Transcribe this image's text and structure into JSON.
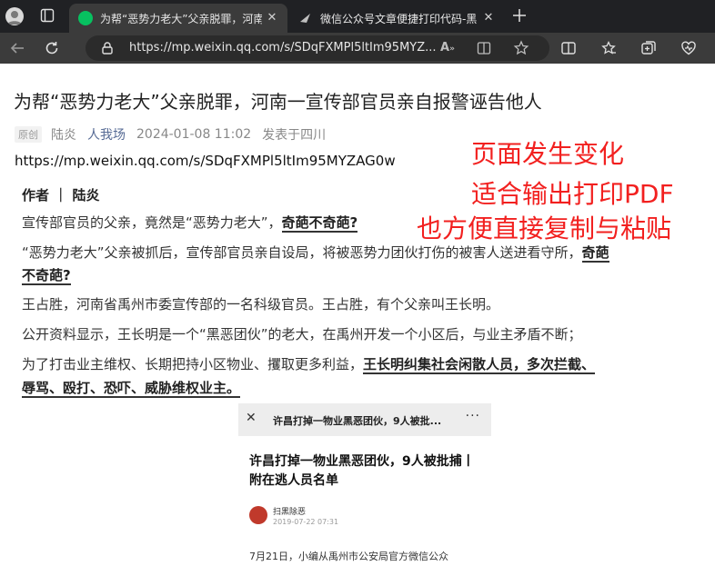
{
  "browser": {
    "tabs": [
      {
        "title": "为帮“恶势力老大”父亲脱罪，河南",
        "active": true
      },
      {
        "title": "微信公众号文章便捷打印代码-黑",
        "active": false
      }
    ],
    "url": "https://mp.weixin.qq.com/s/SDqFXMPl5ltIm95MYZ..."
  },
  "article": {
    "title": "为帮“恶势力老大”父亲脱罪，河南一宣传部官员亲自报警诬告他人",
    "original_badge": "原创",
    "author": "陆炎",
    "account": "人我场",
    "datetime": "2024-01-08 11:02",
    "location": "发表于四川",
    "source_url": "https://mp.weixin.qq.com/s/SDqFXMPl5ltIm95MYZAG0w",
    "byline": "作者 ｜ 陆炎",
    "p1_text": "宣传部官员的父亲，竟然是“恶势力老大”，",
    "p1_bold": "奇葩不奇葩?",
    "p2_text": "“恶势力老大”父亲被抓后，宣传部官员亲自设局，将被恶势力团伙打伤的被害人送进看守所，",
    "p2_bold_a": "奇葩",
    "p2_bold_b": "不奇葩?",
    "p3": "王占胜，河南省禹州市委宣传部的一名科级官员。王占胜，有个父亲叫王长明。",
    "p4": "公开资料显示，王长明是一个“黑恶团伙”的老大，在禹州开发一个小区后，与业主矛盾不断；",
    "p5_text": "为了打击业主维权、长期把持小区物业、攫取更多利益，",
    "p5_bold_a": "王长明纠集社会闲散人员，多次拦截、",
    "p5_bold_b": "辱骂、殴打、恐吓、威胁维权业主。"
  },
  "overlay": {
    "line1": "页面发生变化",
    "line2": "适合输出打印PDF",
    "line3": "也方便直接复制与粘贴",
    "color": "#f2201f"
  },
  "card": {
    "top_title": "许昌打掉一物业黑恶团伙，9人被批...",
    "title": "许昌打掉一物业黑恶团伙，9人被批捕丨附在逃人员名单",
    "account": "扫黑除恶",
    "date": "2019-07-22 07:31",
    "text": "7月21日，小编从禹州市公安局官方微信公众"
  }
}
